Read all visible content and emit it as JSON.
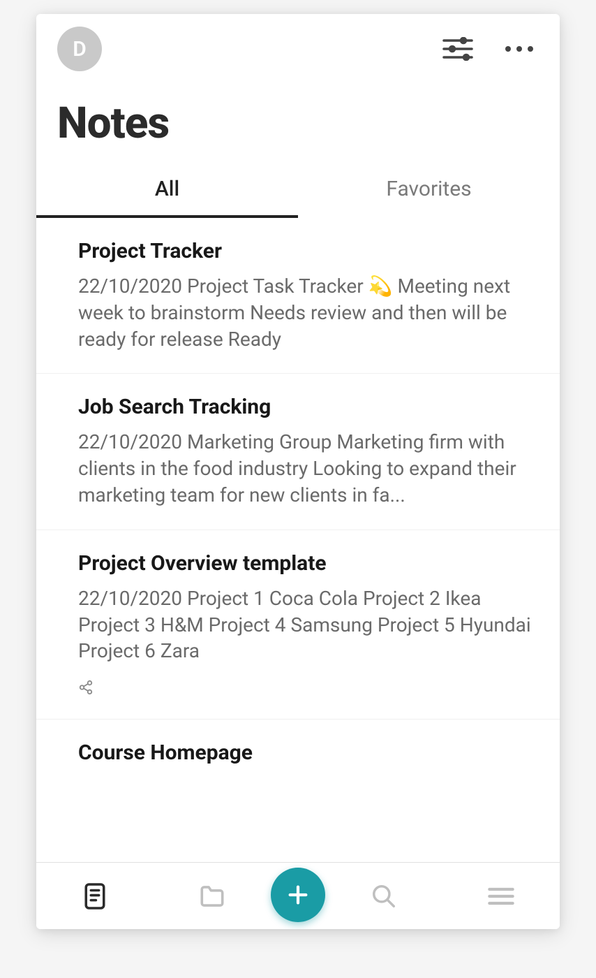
{
  "header": {
    "avatar_letter": "D",
    "page_title": "Notes"
  },
  "tabs": [
    {
      "label": "All",
      "active": true
    },
    {
      "label": "Favorites",
      "active": false
    }
  ],
  "notes": [
    {
      "title": "Project Tracker",
      "preview": "22/10/2020 Project Task Tracker 💫 Meeting next week to brainstorm Needs review and then will be ready for release Ready",
      "shared": false
    },
    {
      "title": "Job Search Tracking",
      "preview": "22/10/2020 Marketing Group Marketing firm with clients in the food industry Looking to expand their marketing team for new clients in fa...",
      "shared": false
    },
    {
      "title": "Project Overview template",
      "preview": "22/10/2020 Project 1 Coca Cola Project 2 Ikea Project 3 H&M Project 4 Samsung Project 5 Hyundai Project 6 Zara",
      "shared": true
    },
    {
      "title": "Course Homepage",
      "preview": "",
      "shared": false
    }
  ],
  "colors": {
    "fab": "#1a9ca5"
  }
}
